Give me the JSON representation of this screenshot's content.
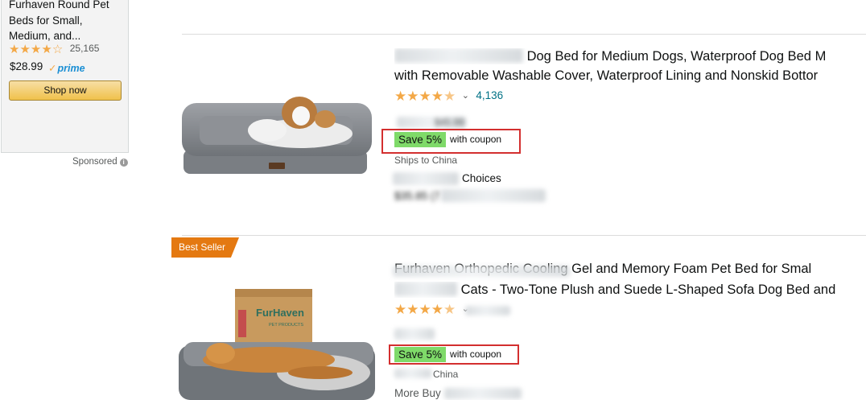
{
  "sidebar_ad": {
    "title_lines": [
      "Furhaven Round Pet",
      "Beds for Small,",
      "Medium, and..."
    ],
    "rating": 4.5,
    "rating_count": "25,165",
    "price": "$28.99",
    "prime_label": "prime",
    "shop_button_label": "Shop now",
    "sponsored_label": "Sponsored",
    "info_icon": "info-icon"
  },
  "products": [
    {
      "title_line1": "Dog Bed for Medium Dogs, Waterproof Dog Bed M",
      "title_line2": "with Removable Washable Cover, Waterproof Lining and Nonskid Bottor",
      "rating": 4.5,
      "rating_count": "4,136",
      "price_partial": "$45.99",
      "coupon_badge": "Save 5%",
      "coupon_text": "with coupon",
      "ships_to": "Ships to China",
      "more_choices": "Choices",
      "offer_price": "$35.85 (7"
    },
    {
      "badge": "Best Seller",
      "title_line1": "Furhaven Orthopedic Cooling Gel and Memory Foam Pet Bed for Smal",
      "title_line2": "Cats - Two-Tone Plush and Suede L-Shaped Sofa Dog Bed and",
      "rating": 4.5,
      "coupon_badge": "Save 5%",
      "coupon_text": "with coupon",
      "ships_to": "China",
      "more_choices": "More Buy",
      "box_brand": "FurHaven",
      "box_sub": "PET PRODUCTS"
    }
  ],
  "colors": {
    "star": "#f3a847",
    "coupon_green": "#7fda69",
    "highlight_red": "#d32f2f",
    "link_teal": "#007185",
    "best_seller_orange": "#e47911"
  }
}
